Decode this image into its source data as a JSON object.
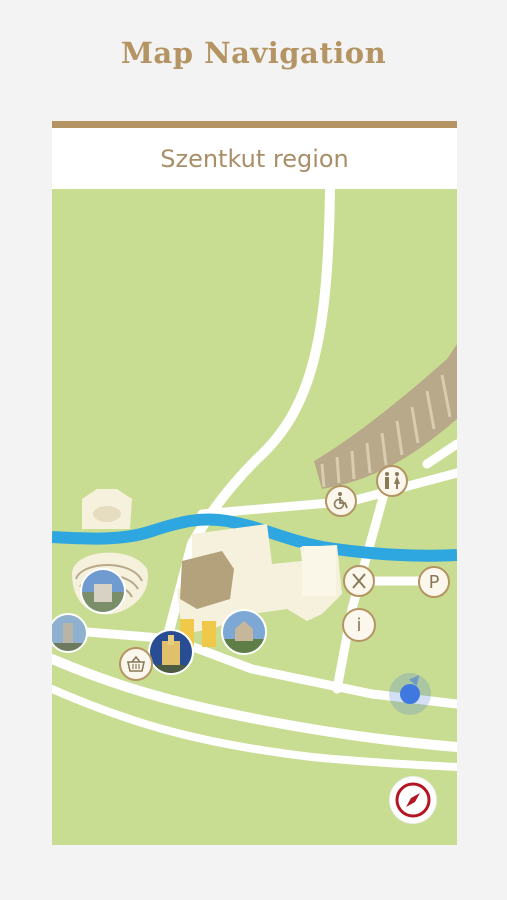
{
  "app_title": "Map Navigation",
  "region_title": "Szentkut region",
  "colors": {
    "accent": "#b59463",
    "map_background": "#c8dd91",
    "road": "#ffffff",
    "river": "#2ea6e0",
    "building": "#f6f1dd",
    "location": "#3f78de",
    "compass": "#b31622"
  },
  "pois": {
    "parking_label": "P",
    "info_label": "i",
    "restaurant_icon": "fork-knife-icon",
    "accessibility_icon": "wheelchair-icon",
    "toilet_icon": "restroom-icon",
    "shop_icon": "basket-icon"
  },
  "controls": {
    "compass_icon": "compass-icon",
    "location_icon": "user-location-icon"
  }
}
